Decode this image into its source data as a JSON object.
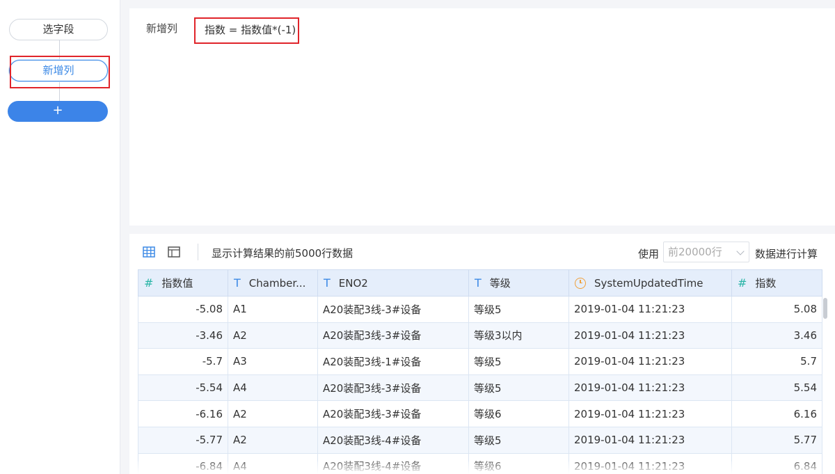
{
  "steps": {
    "select_field": "选字段",
    "new_column": "新增列",
    "add": "+"
  },
  "formula_panel": {
    "label": "新增列",
    "formula": "指数 = 指数值*(-1)"
  },
  "toolbar": {
    "grid_view_icon": "grid-view-icon",
    "table_view_icon": "table-view-icon",
    "hint": "显示计算结果的前5000行数据",
    "use_label": "使用",
    "row_limit_selected": "前20000行",
    "calc_label": "数据进行计算"
  },
  "table": {
    "columns": [
      {
        "type": "#",
        "label": "指数值"
      },
      {
        "type": "T",
        "label": "Chamber..."
      },
      {
        "type": "T",
        "label": "ENO2"
      },
      {
        "type": "T",
        "label": "等级"
      },
      {
        "type": "clock",
        "label": "SystemUpdatedTime"
      },
      {
        "type": "#",
        "label": "指数"
      }
    ],
    "rows": [
      [
        "-5.08",
        "A1",
        "A20装配3线-3#设备",
        "等级5",
        "2019-01-04 11:21:23",
        "5.08"
      ],
      [
        "-3.46",
        "A2",
        "A20装配3线-3#设备",
        "等级3以内",
        "2019-01-04 11:21:23",
        "3.46"
      ],
      [
        "-5.7",
        "A3",
        "A20装配3线-1#设备",
        "等级5",
        "2019-01-04 11:21:23",
        "5.7"
      ],
      [
        "-5.54",
        "A4",
        "A20装配3线-3#设备",
        "等级5",
        "2019-01-04 11:21:23",
        "5.54"
      ],
      [
        "-6.16",
        "A2",
        "A20装配3线-3#设备",
        "等级6",
        "2019-01-04 11:21:23",
        "6.16"
      ],
      [
        "-5.77",
        "A2",
        "A20装配3线-4#设备",
        "等级5",
        "2019-01-04 11:21:23",
        "5.77"
      ],
      [
        "-6.84",
        "A4",
        "A20装配3线-4#设备",
        "等级6",
        "2019-01-04 11:21:23",
        "6.84"
      ]
    ]
  },
  "colors": {
    "accent": "#3d8ae6",
    "highlight": "#e0242a",
    "header_bg": "#e5eefb",
    "number_type": "#2bb5a7",
    "time_type": "#f0a03a"
  }
}
